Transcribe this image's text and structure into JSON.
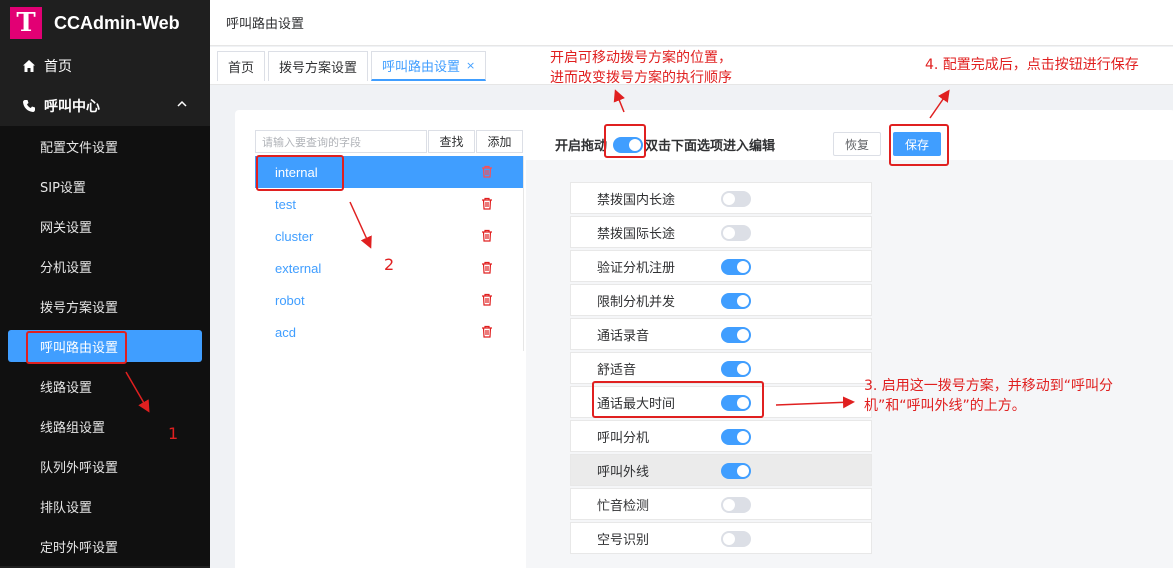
{
  "app": {
    "logo_letter": "T",
    "title": "CCAdmin-Web"
  },
  "sidebar": {
    "home": "首页",
    "group": "呼叫中心",
    "items": [
      {
        "label": "配置文件设置"
      },
      {
        "label": "SIP设置"
      },
      {
        "label": "网关设置"
      },
      {
        "label": "分机设置"
      },
      {
        "label": "拨号方案设置"
      },
      {
        "label": "呼叫路由设置",
        "active": true
      },
      {
        "label": "线路设置"
      },
      {
        "label": "线路组设置"
      },
      {
        "label": "队列外呼设置"
      },
      {
        "label": "排队设置"
      },
      {
        "label": "定时外呼设置"
      }
    ]
  },
  "header": {
    "breadcrumb": "呼叫路由设置"
  },
  "tabs": [
    {
      "label": "首页"
    },
    {
      "label": "拨号方案设置"
    },
    {
      "label": "呼叫路由设置",
      "active": true,
      "close": "×"
    }
  ],
  "search": {
    "placeholder": "请输入要查询的字段",
    "find_label": "查找",
    "add_label": "添加"
  },
  "routes": [
    "internal",
    "test",
    "cluster",
    "external",
    "robot",
    "acd"
  ],
  "toolbar": {
    "drag_label": "开启拖动",
    "hint": "双击下面选项进入编辑",
    "restore_label": "恢复",
    "save_label": "保存"
  },
  "options": [
    {
      "label": "禁拨国内长途",
      "on": false
    },
    {
      "label": "禁拨国际长途",
      "on": false
    },
    {
      "label": "验证分机注册",
      "on": true
    },
    {
      "label": "限制分机并发",
      "on": true
    },
    {
      "label": "通话录音",
      "on": true
    },
    {
      "label": "舒适音",
      "on": true
    },
    {
      "label": "通话最大时间",
      "on": true
    },
    {
      "label": "呼叫分机",
      "on": true
    },
    {
      "label": "呼叫外线",
      "on": true
    },
    {
      "label": "忙音检测",
      "on": false
    },
    {
      "label": "空号识别",
      "on": false
    }
  ],
  "annotations": {
    "drag_note_line1": "开启可移动拨号方案的位置，",
    "drag_note_line2": "进而改变拨号方案的执行顺序",
    "save_note": "4. 配置完成后，点击按钮进行保存",
    "step3_line1": "3. 启用这一拨号方案，并移动到“呼叫分",
    "step3_line2": "机”和“呼叫外线”的上方。",
    "num1": "1",
    "num2": "2"
  },
  "colors": {
    "accent": "#409eff",
    "brand": "#e20074",
    "annotation": "#e02020"
  }
}
